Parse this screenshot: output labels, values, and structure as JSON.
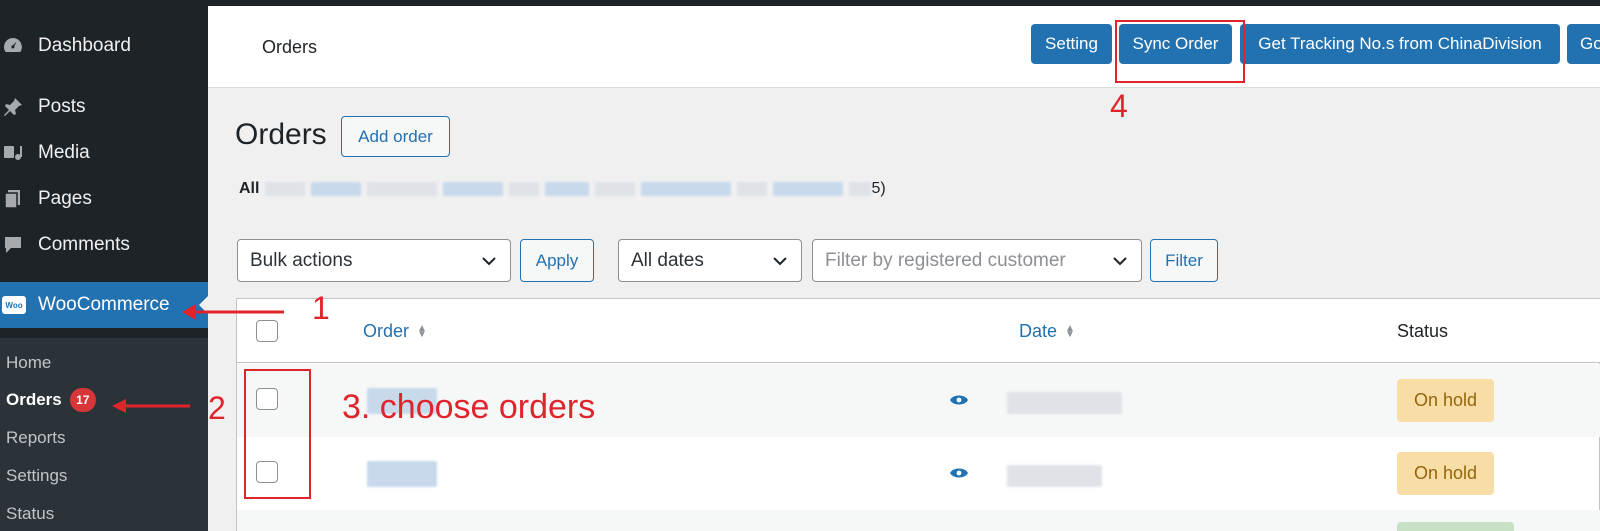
{
  "sidebar": {
    "items": [
      {
        "label": "Dashboard",
        "icon": "dashboard-icon"
      },
      {
        "label": "Posts",
        "icon": "pin-icon"
      },
      {
        "label": "Media",
        "icon": "media-icon"
      },
      {
        "label": "Pages",
        "icon": "pages-icon"
      },
      {
        "label": "Comments",
        "icon": "comment-icon"
      },
      {
        "label": "WooCommerce",
        "icon": "woocommerce-icon",
        "logo_text": "Woo"
      }
    ],
    "submenu": [
      {
        "label": "Home"
      },
      {
        "label": "Orders",
        "badge": "17"
      },
      {
        "label": "Reports"
      },
      {
        "label": "Settings"
      },
      {
        "label": "Status"
      }
    ]
  },
  "header": {
    "title": "Orders",
    "buttons": [
      "Setting",
      "Sync Order",
      "Get Tracking No.s from ChinaDivision",
      "Go"
    ]
  },
  "main": {
    "title": "Orders",
    "add_button": "Add order",
    "filter_all": "All",
    "filter_tail": "5)",
    "bulk_actions": "Bulk actions",
    "apply": "Apply",
    "dates": "All dates",
    "customer_placeholder": "Filter by registered customer",
    "filter": "Filter"
  },
  "table": {
    "columns": [
      "Order",
      "Date",
      "Status"
    ],
    "rows": [
      {
        "status": "On hold"
      },
      {
        "status": "On hold"
      }
    ]
  },
  "annotations": {
    "step1": "1",
    "step2": "2",
    "step3": "3. choose orders",
    "step4": "4"
  },
  "colors": {
    "accent": "#2271b1",
    "sidebar": "#1d2327",
    "annotation": "#e0242c",
    "on_hold_bg": "#f8dda7"
  }
}
